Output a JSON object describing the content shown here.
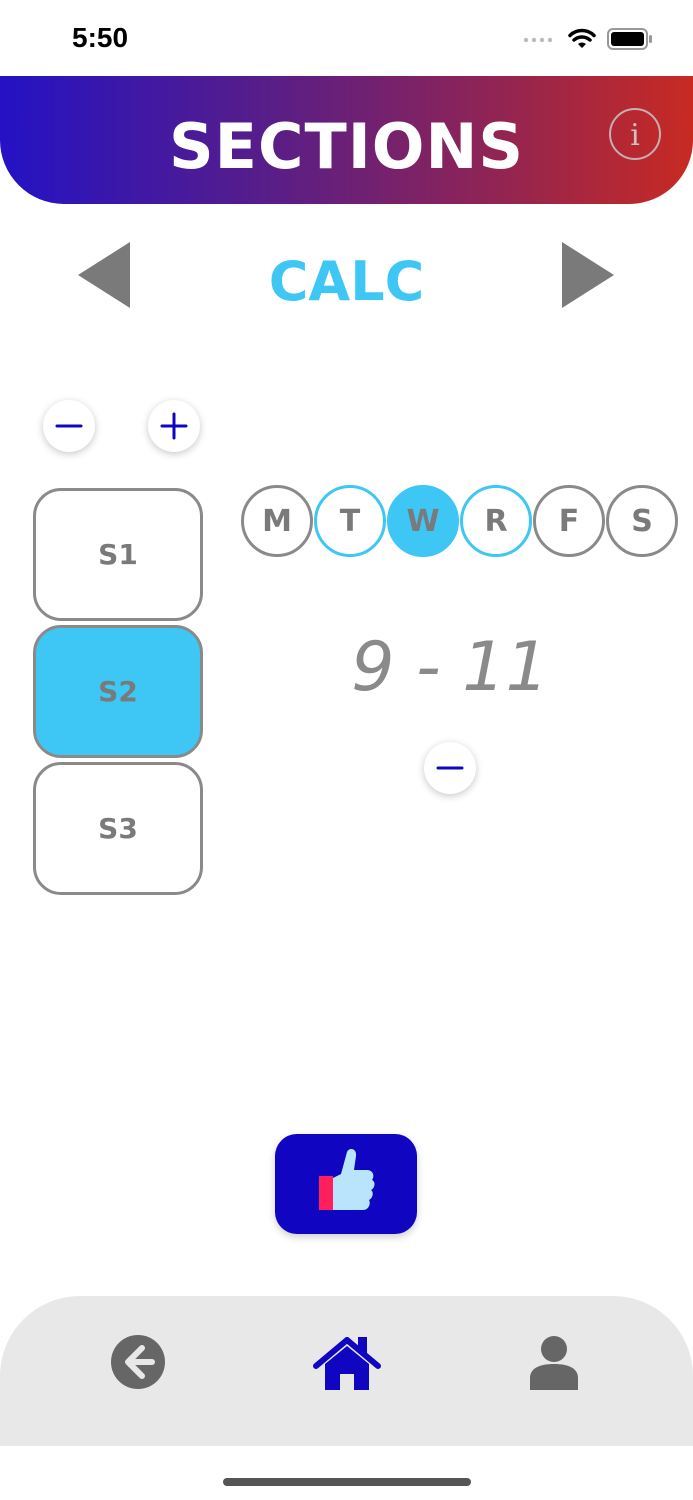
{
  "status_bar": {
    "time": "5:50"
  },
  "header": {
    "title": "SECTIONS",
    "info_glyph": "i"
  },
  "course": {
    "name": "CALC"
  },
  "section_controls": {
    "remove_glyph": "remove-icon",
    "add_glyph": "add-icon"
  },
  "sections": [
    {
      "label": "S1",
      "selected": false
    },
    {
      "label": "S2",
      "selected": true
    },
    {
      "label": "S3",
      "selected": false
    }
  ],
  "days": [
    {
      "label": "M",
      "state": "off"
    },
    {
      "label": "T",
      "state": "outlined"
    },
    {
      "label": "W",
      "state": "selected"
    },
    {
      "label": "R",
      "state": "outlined"
    },
    {
      "label": "F",
      "state": "off"
    },
    {
      "label": "S",
      "state": "off"
    }
  ],
  "time_range": "9 - 11",
  "colors": {
    "accent": "#3ec6f5",
    "primary": "#1006c2",
    "header_gradient": [
      "#2412c4",
      "#c82a22"
    ],
    "neutral": "#8a8a8a"
  },
  "tab_bar": {
    "items": [
      {
        "icon": "back-arrow-icon"
      },
      {
        "icon": "home-icon",
        "active": true
      },
      {
        "icon": "person-icon"
      }
    ]
  }
}
